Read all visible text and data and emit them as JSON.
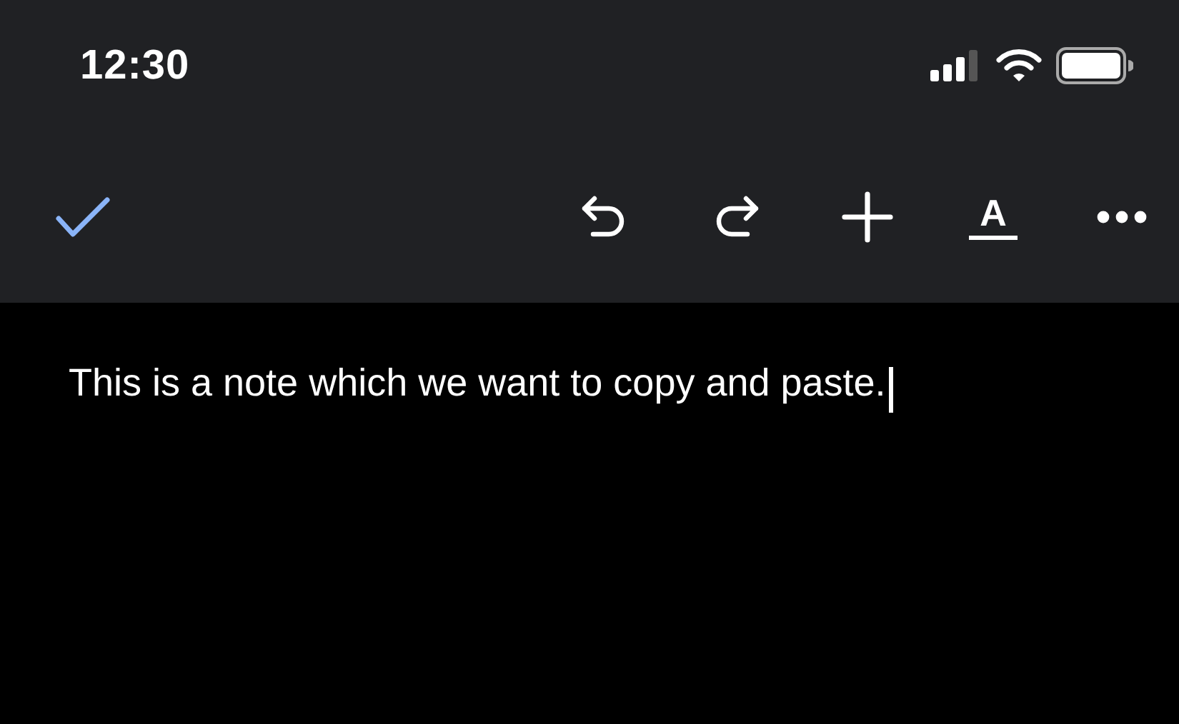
{
  "status_bar": {
    "time": "12:30"
  },
  "toolbar": {
    "format_label": "A"
  },
  "note": {
    "text": "This is a note which we want to copy and paste."
  }
}
